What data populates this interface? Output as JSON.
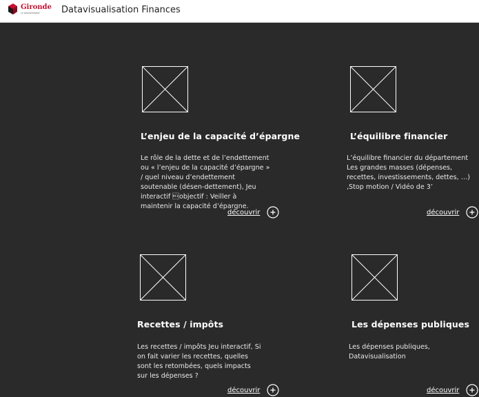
{
  "header": {
    "logo": {
      "name": "Gironde",
      "tagline": "LE DÉPARTEMENT",
      "icon": "gironde-logo-icon"
    },
    "app_title": "Datavisualisation Finances"
  },
  "colors": {
    "background": "#2a2a2a",
    "header_background": "#ffffff",
    "brand_red": "#c8102e",
    "text": "#ffffff"
  },
  "cards": [
    {
      "title": "L’enjeu de la capacité d’épargne",
      "description": "Le rôle de la dette et de l’endettement ou « l’enjeu de la capacité d’épargne » / quel niveau d’endettement soutenable (désen-dettement), Jeu interactif \u0012objectif : Veiller à maintenir la capacité d’épargne.",
      "link_label": "découvrir",
      "thumbnail_icon": "image-placeholder-icon",
      "link_icon": "plus-circle-icon"
    },
    {
      "title": "L’équilibre financier",
      "description": "L’équilibre financier du département Les grandes masses (dépenses, recettes, investissements, dettes, …) ,Stop motion / Vidéo de 3’",
      "link_label": "découvrir",
      "thumbnail_icon": "image-placeholder-icon",
      "link_icon": "plus-circle-icon"
    },
    {
      "title": "Recettes / impôts",
      "description": "Les recettes / impôts Jeu interactif, Si on fait varier les recettes, quelles sont les retombées, quels impacts sur les dépenses ?",
      "link_label": "découvrir",
      "thumbnail_icon": "image-placeholder-icon",
      "link_icon": "plus-circle-icon"
    },
    {
      "title": "Les dépenses publiques",
      "description": "Les dépenses publiques, Datavisualisation",
      "link_label": "découvrir",
      "thumbnail_icon": "image-placeholder-icon",
      "link_icon": "plus-circle-icon"
    }
  ]
}
